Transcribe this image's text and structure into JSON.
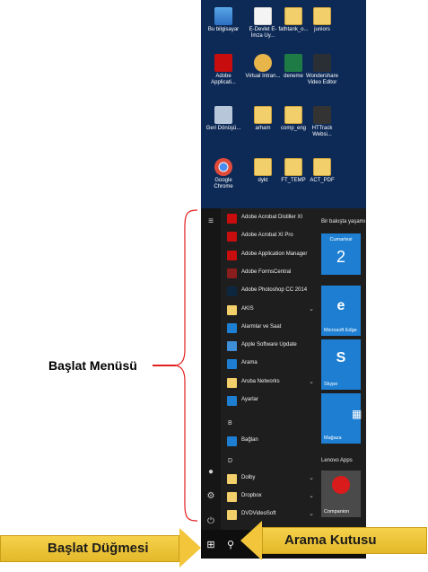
{
  "desktop_icons": [
    {
      "label": "Bu bilgisayar",
      "icon": "computer-icon",
      "cls": "pc"
    },
    {
      "label": "E-Devlet E-İmza Uy...",
      "icon": "document-icon",
      "cls": "doc"
    },
    {
      "label": "fathtank_o...",
      "icon": "folder-icon",
      "cls": "folder"
    },
    {
      "label": "juniors",
      "icon": "folder-icon",
      "cls": "folder"
    },
    {
      "label": "Adobe Applicati...",
      "icon": "adobe-icon",
      "cls": "adobe"
    },
    {
      "label": "Virtual Intran...",
      "icon": "vpn-icon",
      "cls": "vm"
    },
    {
      "label": "deneme",
      "icon": "excel-icon",
      "cls": "excel"
    },
    {
      "label": "Wondershare Video Editor",
      "icon": "video-editor-icon",
      "cls": "ws"
    },
    {
      "label": "Geri Dönüşü...",
      "icon": "recycle-bin-icon",
      "cls": "bin"
    },
    {
      "label": "arham",
      "icon": "folder-icon",
      "cls": "folder"
    },
    {
      "label": "comp_eng",
      "icon": "folder-icon",
      "cls": "folder"
    },
    {
      "label": "HTTrack Websi...",
      "icon": "httrack-icon",
      "cls": "httrack"
    },
    {
      "label": "Google Chrome",
      "icon": "chrome-icon",
      "cls": "chrome"
    },
    {
      "label": "dykt",
      "icon": "folder-icon",
      "cls": "folder"
    },
    {
      "label": "FT_TEMP",
      "icon": "folder-icon",
      "cls": "folder"
    },
    {
      "label": "ACT_PDF",
      "icon": "folder-icon",
      "cls": "folder"
    }
  ],
  "start_menu": {
    "apps": [
      {
        "label": "Adobe Acrobat Distiller XI",
        "icon": "acrobat-distiller-icon",
        "color": "#c70d0d",
        "chevron": ""
      },
      {
        "label": "Adobe Acrobat XI Pro",
        "icon": "acrobat-icon",
        "color": "#c70d0d",
        "chevron": ""
      },
      {
        "label": "Adobe Application Manager",
        "icon": "adobe-manager-icon",
        "color": "#c70d0d",
        "chevron": ""
      },
      {
        "label": "Adobe FormsCentral",
        "icon": "forms-central-icon",
        "color": "#8a1d1d",
        "chevron": ""
      },
      {
        "label": "Adobe Photoshop CC 2014",
        "icon": "photoshop-icon",
        "color": "#0d2740",
        "chevron": ""
      },
      {
        "label": "AKIS",
        "icon": "folder-icon",
        "color": "#f3cf6b",
        "chevron": "⌄"
      },
      {
        "label": "Alarmlar ve Saat",
        "icon": "alarm-icon",
        "color": "#1e7fd2",
        "chevron": ""
      },
      {
        "label": "Apple Software Update",
        "icon": "apple-update-icon",
        "color": "#3f8ed8",
        "chevron": ""
      },
      {
        "label": "Arama",
        "icon": "search-icon",
        "color": "#1e7fd2",
        "chevron": ""
      },
      {
        "label": "Aruba Networks",
        "icon": "folder-icon",
        "color": "#f3cf6b",
        "chevron": "⌄"
      },
      {
        "label": "Ayarlar",
        "icon": "gear-icon",
        "color": "#1e7fd2",
        "chevron": ""
      }
    ],
    "letter_b": "B",
    "app_baglan": {
      "label": "Bağlan",
      "icon": "connect-icon",
      "color": "#1e7fd2"
    },
    "letter_d": "D",
    "apps_d": [
      {
        "label": "Dolby",
        "icon": "folder-icon",
        "color": "#f3cf6b",
        "chevron": "⌄"
      },
      {
        "label": "Dropbox",
        "icon": "folder-icon",
        "color": "#f3cf6b",
        "chevron": "⌄"
      },
      {
        "label": "DVDVideoSoft",
        "icon": "folder-icon",
        "color": "#f3cf6b",
        "chevron": "⌄"
      }
    ],
    "tiles_header": "Bir bakışta yaşamı",
    "calendar_day": "Cumartesi",
    "calendar_date": "2",
    "edge_label": "Microsoft Edge",
    "skype_label": "Skype",
    "store_label": "Mağaza",
    "lenovo_header": "Lenovo Apps",
    "companion_label": "Companion"
  },
  "annotations": {
    "start_menu_label": "Başlat Menüsü",
    "start_button_label": "Başlat Düğmesi",
    "search_box_label": "Arama Kutusu"
  },
  "colors": {
    "accent": "#1e7fd2",
    "banner": "#f2c53a",
    "bracket": "#e21f1f"
  }
}
